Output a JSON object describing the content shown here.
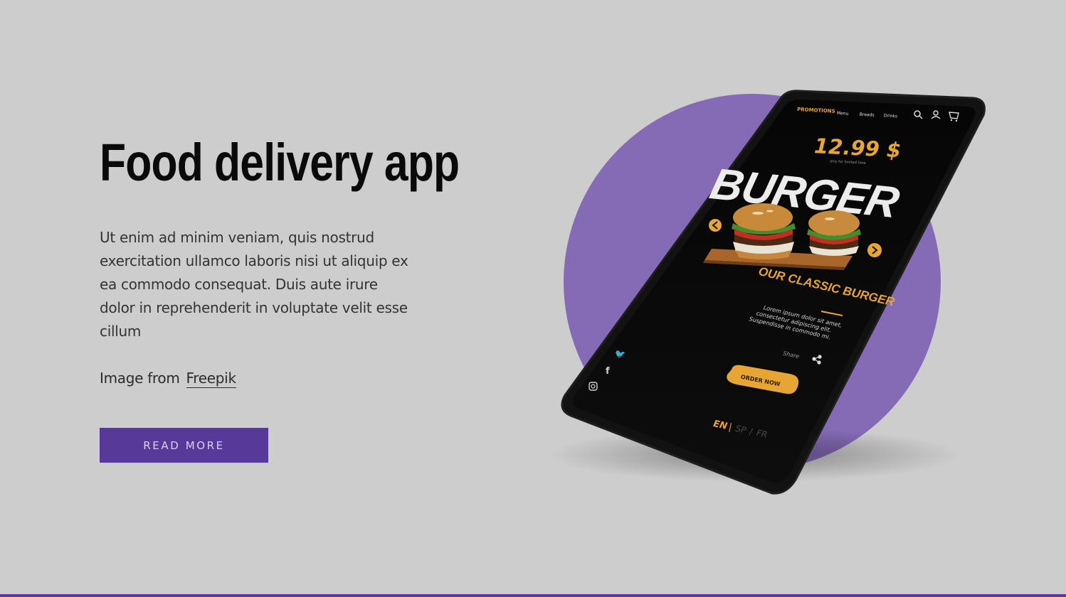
{
  "hero": {
    "title": "Food delivery app",
    "body": "Ut enim ad minim veniam, quis nostrud exercitation ullamco laboris nisi ut aliquip ex ea commodo consequat. Duis aute irure dolor in reprehenderit in voluptate velit esse cillum",
    "credit_prefix": "Image from",
    "credit_link": "Freepik",
    "read_more_label": "READ MORE"
  },
  "phone_screen": {
    "brand": "PROMOTIONS",
    "nav_items": [
      "Menu",
      "Breads",
      "Drinks"
    ],
    "price": "12.99 $",
    "price_caption": "only for limited time",
    "headline": "BURGER",
    "product_title": "OUR CLASSIC BURGER",
    "description_lines": [
      "Lorem ipsum dolor sit amet,",
      "consectetur adipiscing elit.",
      "Suspendisse in commodo mi."
    ],
    "share_label": "Share",
    "order_button": "ORDER NOW",
    "language_active": "EN",
    "language_others": [
      "SP",
      "FR"
    ]
  },
  "colors": {
    "background": "#cdcdcd",
    "accent_purple": "#57399a",
    "circle_purple": "#856bb6",
    "screen_gold": "#e7a534",
    "phone_body": "#121212"
  },
  "icons": [
    "search-icon",
    "user-icon",
    "cart-icon",
    "twitter-icon",
    "facebook-icon",
    "instagram-icon",
    "share-icon",
    "arrow-left-icon",
    "arrow-right-icon"
  ]
}
